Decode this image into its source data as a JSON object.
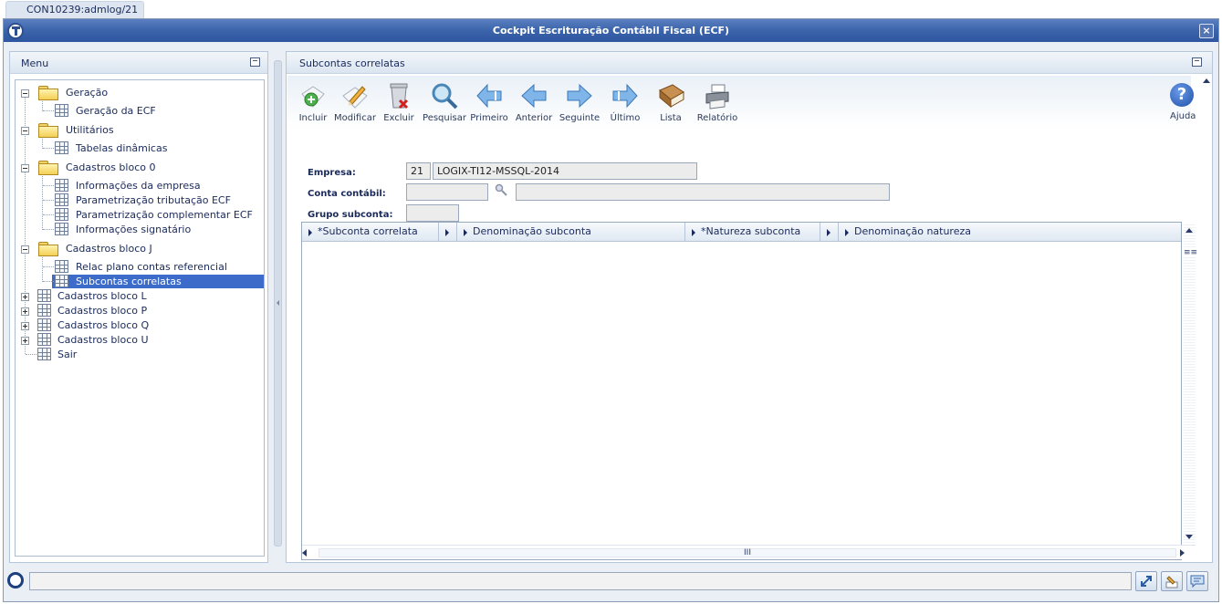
{
  "tab": {
    "label": "CON10239:admlog/21"
  },
  "window": {
    "title": "Cockpit Escrituração Contábil Fiscal (ECF)",
    "close_label": "×"
  },
  "menu": {
    "title": "Menu",
    "tree": [
      {
        "label": "Geração",
        "type": "folder",
        "expanded": true
      },
      {
        "label": "Geração da ECF",
        "type": "item"
      },
      {
        "label": "Utilitários",
        "type": "folder",
        "expanded": true
      },
      {
        "label": "Tabelas dinâmicas",
        "type": "item"
      },
      {
        "label": "Cadastros bloco 0",
        "type": "folder",
        "expanded": true
      },
      {
        "label": "Informações da empresa",
        "type": "item"
      },
      {
        "label": "Parametrização tributação ECF",
        "type": "item"
      },
      {
        "label": "Parametrização complementar ECF",
        "type": "item"
      },
      {
        "label": "Informações signatário",
        "type": "item"
      },
      {
        "label": "Cadastros bloco J",
        "type": "folder",
        "expanded": true
      },
      {
        "label": "Relac plano contas referencial",
        "type": "item"
      },
      {
        "label": "Subcontas correlatas",
        "type": "item",
        "selected": true
      },
      {
        "label": "Cadastros bloco L",
        "type": "group",
        "expanded": false
      },
      {
        "label": "Cadastros bloco P",
        "type": "group",
        "expanded": false
      },
      {
        "label": "Cadastros bloco Q",
        "type": "group",
        "expanded": false
      },
      {
        "label": "Cadastros bloco U",
        "type": "group",
        "expanded": false
      },
      {
        "label": "Sair",
        "type": "leaf"
      }
    ]
  },
  "content": {
    "title": "Subcontas correlatas",
    "toolbar": {
      "incluir": "Incluir",
      "modificar": "Modificar",
      "excluir": "Excluir",
      "pesquisar": "Pesquisar",
      "primeiro": "Primeiro",
      "anterior": "Anterior",
      "seguinte": "Seguinte",
      "ultimo": "Último",
      "lista": "Lista",
      "relatorio": "Relatório",
      "ajuda": "Ajuda"
    },
    "form": {
      "empresa_label": "Empresa:",
      "empresa_code": "21",
      "empresa_name": "LOGIX-TI12-MSSQL-2014",
      "conta_label": "Conta contábil:",
      "conta_value": "",
      "conta_desc": "",
      "grupo_label": "Grupo subconta:",
      "grupo_value": ""
    },
    "grid": {
      "columns": [
        "*Subconta correlata",
        "Denominação subconta",
        "*Natureza subconta",
        "Denominação natureza"
      ],
      "rows": [],
      "scroll_thumb": "III"
    }
  },
  "status": {
    "text": ""
  },
  "colors": {
    "titlebar": "#3b64aa",
    "selection": "#3d6bc9",
    "panel_bg": "#e9eff5"
  }
}
